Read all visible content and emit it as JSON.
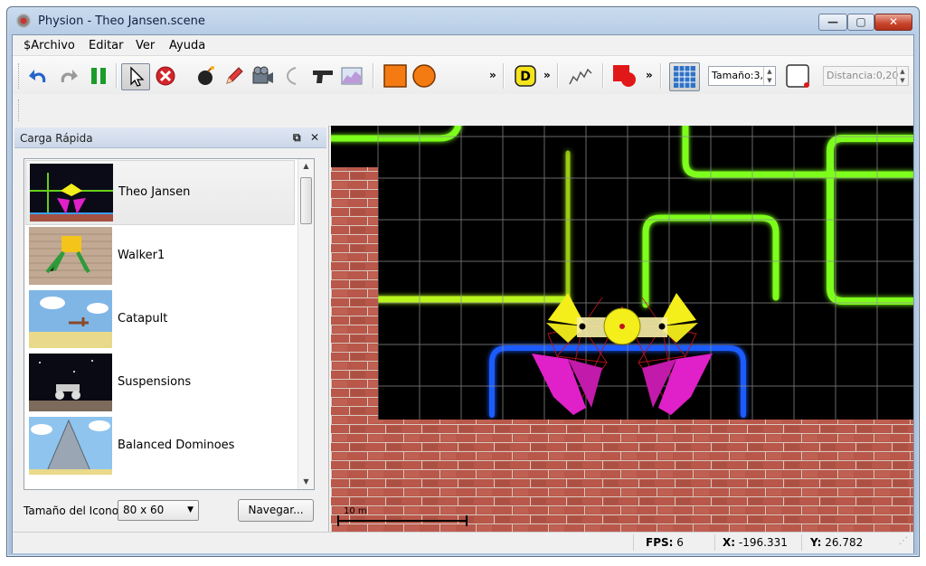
{
  "window": {
    "title": "Physion - Theo Jansen.scene",
    "min_label": "—",
    "max_label": "▢",
    "close_label": "✕"
  },
  "menu": [
    "$Archivo",
    "Editar",
    "Ver",
    "Ayuda"
  ],
  "toolbar": {
    "icons": [
      "undo-icon",
      "redo-icon",
      "pause-icon",
      "select-arrow-icon",
      "delete-icon",
      "bomb-icon",
      "pencil-icon",
      "camera-icon",
      "rope-icon",
      "gun-icon",
      "graph-icon",
      "rectangle-tool-icon",
      "circle-tool-icon",
      "d-shape-icon",
      "spring-icon",
      "shape-tool-icon",
      "grid-icon",
      "box-tool-icon"
    ],
    "chevron": "»",
    "size_label": "Tamaño:3,",
    "distance_label": "Distancia:0,20"
  },
  "panel": {
    "title": "Carga Rápida",
    "float_icon": "restore-icon",
    "close_icon": "close-icon",
    "items": [
      {
        "label": "Theo Jansen"
      },
      {
        "label": "Walker1"
      },
      {
        "label": "Catapult"
      },
      {
        "label": "Suspensions"
      },
      {
        "label": "Balanced Dominoes"
      }
    ],
    "icon_size_label": "Tamaño del Icono",
    "icon_size_value": "80 x 60",
    "browse_label": "Navegar..."
  },
  "scene": {
    "scale_label": "10 m"
  },
  "status": {
    "fps_label": "FPS:",
    "fps": "6",
    "x_label": "X:",
    "x": "-196.331",
    "y_label": "Y:",
    "y": "26.782"
  },
  "colors": {
    "neon_green": "#7dff1a",
    "neon_blue": "#1e5cff",
    "brick": "#b8574a",
    "grid": "#8c8c8c",
    "creature_yellow": "#f4ee1a",
    "creature_magenta": "#e020c8"
  }
}
